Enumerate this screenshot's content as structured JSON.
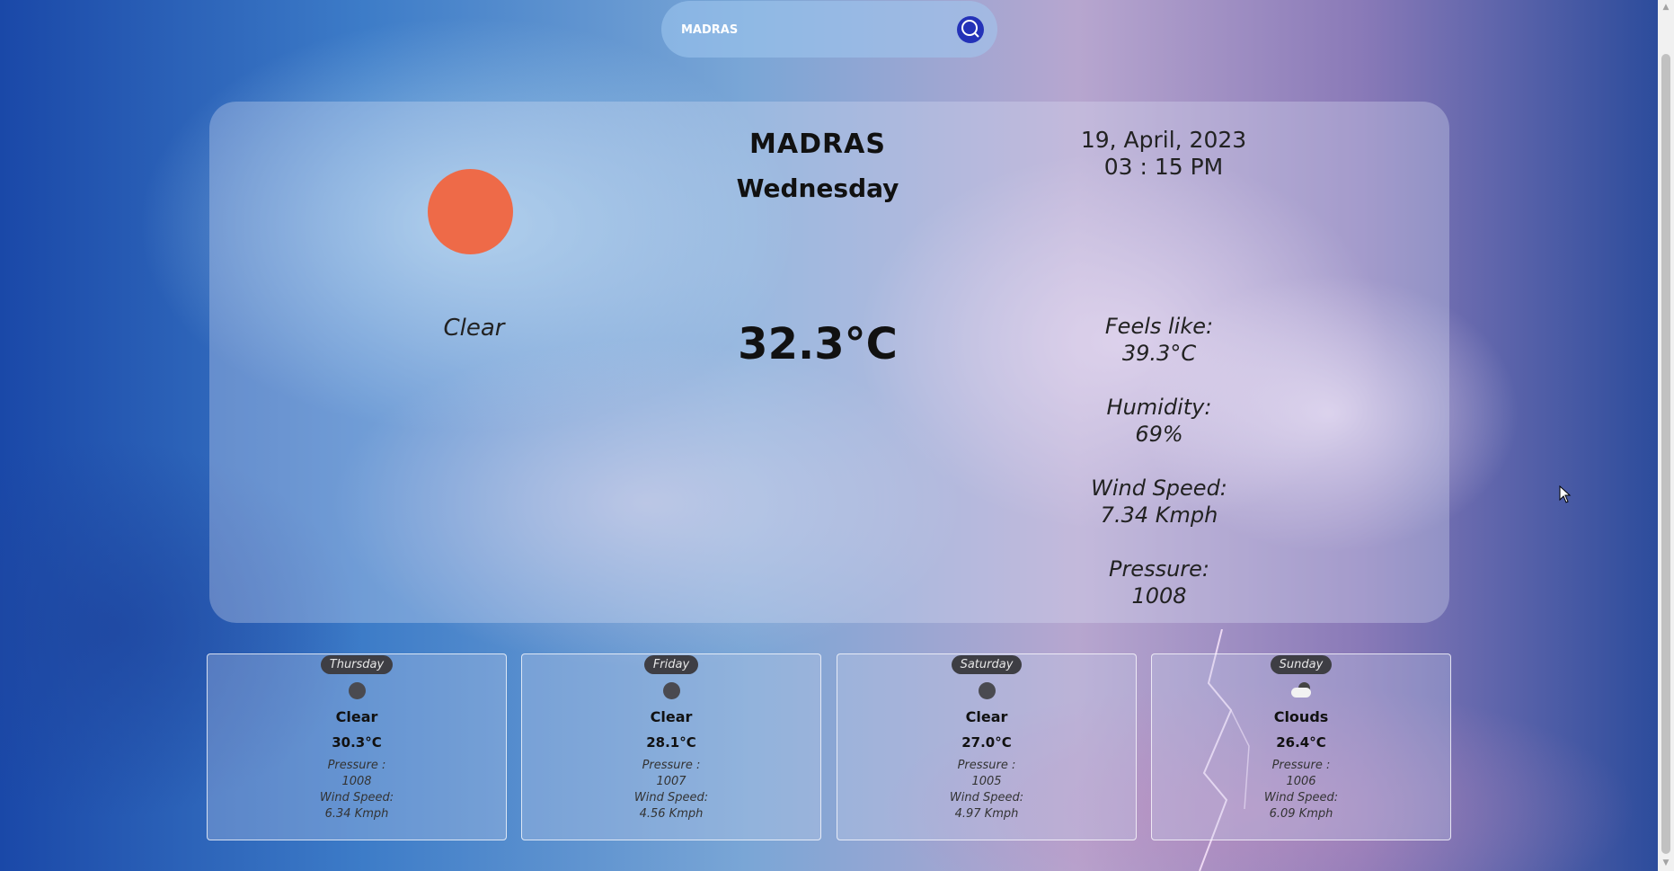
{
  "search": {
    "value": "MADRAS"
  },
  "current": {
    "city": "MADRAS",
    "day": "Wednesday",
    "date": "19, April, 2023",
    "time": "03 : 15 PM",
    "description": "Clear",
    "temperature": "32.3°C",
    "stats": [
      {
        "label": "Feels like:",
        "value": "39.3°C"
      },
      {
        "label": "Humidity:",
        "value": "69%"
      },
      {
        "label": "Wind Speed:",
        "value": "7.34 Kmph"
      },
      {
        "label": "Pressure:",
        "value": "1008"
      }
    ]
  },
  "forecast": [
    {
      "day": "Thursday",
      "icon": "moon-icon",
      "description": "Clear",
      "temperature": "30.3°C",
      "pressure_label": "Pressure :",
      "pressure": "1008",
      "wind_label": "Wind Speed:",
      "wind": "6.34 Kmph"
    },
    {
      "day": "Friday",
      "icon": "moon-icon",
      "description": "Clear",
      "temperature": "28.1°C",
      "pressure_label": "Pressure :",
      "pressure": "1007",
      "wind_label": "Wind Speed:",
      "wind": "4.56 Kmph"
    },
    {
      "day": "Saturday",
      "icon": "moon-icon",
      "description": "Clear",
      "temperature": "27.0°C",
      "pressure_label": "Pressure :",
      "pressure": "1005",
      "wind_label": "Wind Speed:",
      "wind": "4.97 Kmph"
    },
    {
      "day": "Sunday",
      "icon": "cloud-icon",
      "description": "Clouds",
      "temperature": "26.4°C",
      "pressure_label": "Pressure :",
      "pressure": "1006",
      "wind_label": "Wind Speed:",
      "wind": "6.09 Kmph"
    }
  ],
  "colors": {
    "sun": "#ee6a48",
    "search_button": "#2432b8",
    "badge": "#3e3e44"
  }
}
